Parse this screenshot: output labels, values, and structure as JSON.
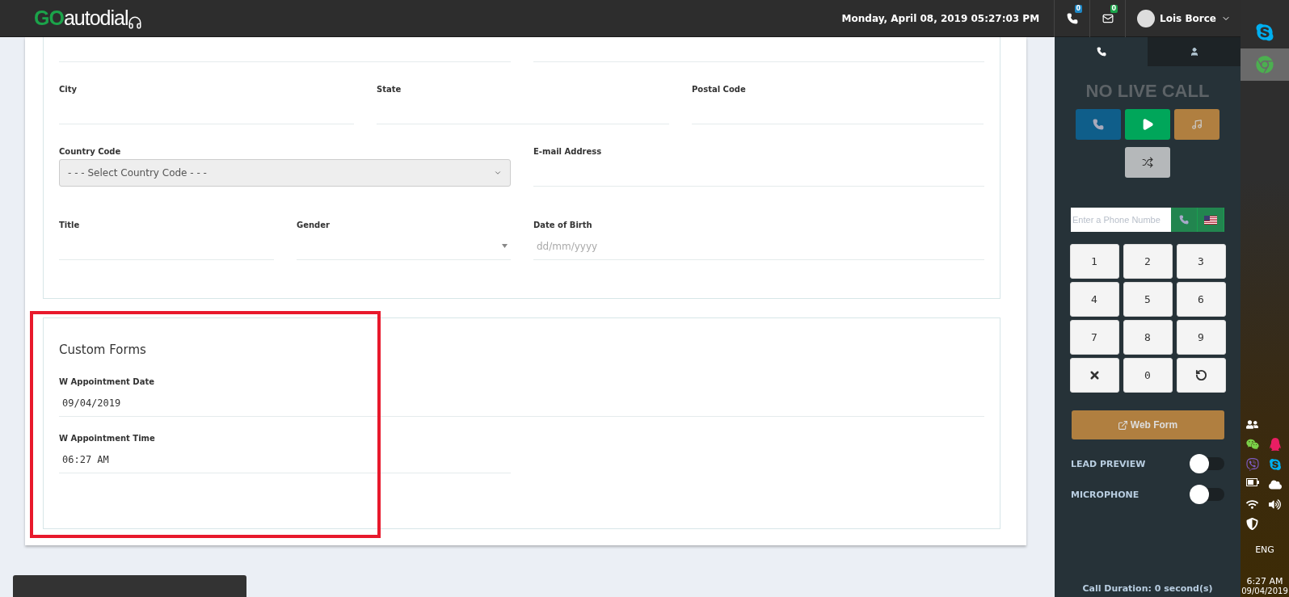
{
  "header": {
    "logo": {
      "part_1": "GO",
      "part_2": "autodial"
    },
    "datetime": "Monday, April 08, 2019 05:27:03 PM",
    "calls_badge": "0",
    "messages_badge": "0",
    "user_name": "Lois Borce"
  },
  "contact_form": {
    "rows": [
      [
        {
          "label": "City",
          "kind": "text"
        },
        {
          "label": "State",
          "kind": "text"
        },
        {
          "label": "Postal Code",
          "kind": "text"
        }
      ],
      [
        {
          "label": "Country Code",
          "kind": "select",
          "placeholder": "- - - Select Country Code - - -"
        },
        {
          "label": "E-mail Address",
          "kind": "text"
        }
      ],
      [
        {
          "label": "Title",
          "kind": "text"
        },
        {
          "label": "Gender",
          "kind": "dropdown"
        },
        {
          "label": "Date of Birth",
          "kind": "text",
          "placeholder": "dd/mm/yyyy"
        }
      ]
    ]
  },
  "custom_forms": {
    "title": "Custom Forms",
    "fields": [
      {
        "label": "W Appointment Date",
        "value": "09/04/2019"
      },
      {
        "label": "W Appointment Time",
        "value": "06:27 AM"
      }
    ]
  },
  "dialer": {
    "tabs": [
      {
        "kind": "phone",
        "selected": true
      },
      {
        "kind": "contact",
        "selected": false
      }
    ],
    "status": "NO LIVE CALL",
    "phone_placeholder": "Enter a Phone Numbe",
    "keys": [
      {
        "kind": "digit",
        "label": "1"
      },
      {
        "kind": "digit",
        "label": "2"
      },
      {
        "kind": "digit",
        "label": "3"
      },
      {
        "kind": "digit",
        "label": "4"
      },
      {
        "kind": "digit",
        "label": "5"
      },
      {
        "kind": "digit",
        "label": "6"
      },
      {
        "kind": "digit",
        "label": "7"
      },
      {
        "kind": "digit",
        "label": "8"
      },
      {
        "kind": "digit",
        "label": "9"
      },
      {
        "kind": "clear"
      },
      {
        "kind": "digit",
        "label": "0"
      },
      {
        "kind": "redo"
      }
    ],
    "web_form": "Web Form",
    "toggles": [
      {
        "label": "LEAD PREVIEW",
        "on": false
      },
      {
        "label": "MICROPHONE",
        "on": false
      }
    ],
    "call_duration": "Call Duration: 0 second(s)"
  },
  "taskbar": {
    "language": "ENG",
    "time": "6:27 AM",
    "date": "09/04/2019"
  }
}
